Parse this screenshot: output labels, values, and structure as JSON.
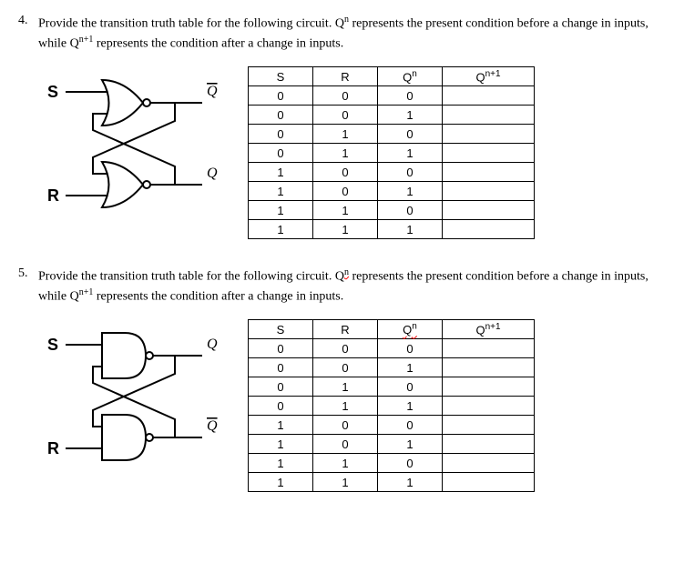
{
  "problems": [
    {
      "number": "4.",
      "text_pre": "Provide the transition truth table for the following circuit. Q",
      "sup1": "n",
      "text_mid": " represents the present condition before a change in inputs, while Q",
      "sup2": "n+1",
      "text_post": " represents the condition after a change in inputs.",
      "gate": "nor",
      "q_top_bar": true,
      "headers": {
        "c1": "S",
        "c2": "R",
        "c3": "Q",
        "c3_sup": "n",
        "c4": "Q",
        "c4_sup": "n+1",
        "squiggle": false
      },
      "rows": [
        [
          "0",
          "0",
          "0",
          ""
        ],
        [
          "0",
          "0",
          "1",
          ""
        ],
        [
          "0",
          "1",
          "0",
          ""
        ],
        [
          "0",
          "1",
          "1",
          ""
        ],
        [
          "1",
          "0",
          "0",
          ""
        ],
        [
          "1",
          "0",
          "1",
          ""
        ],
        [
          "1",
          "1",
          "0",
          ""
        ],
        [
          "1",
          "1",
          "1",
          ""
        ]
      ]
    },
    {
      "number": "5.",
      "text_pre": "Provide the transition truth table for the following circuit. Q",
      "sup1": "n",
      "text_mid": " represents the present condition before a change in inputs, while Q",
      "sup2": "n+1",
      "text_post": " represents the condition after a change in inputs.",
      "gate": "nand",
      "q_top_bar": false,
      "headers": {
        "c1": "S",
        "c2": "R",
        "c3": "Q",
        "c3_sup": "n",
        "c4": "Q",
        "c4_sup": "n+1",
        "squiggle": true
      },
      "rows": [
        [
          "0",
          "0",
          "0",
          ""
        ],
        [
          "0",
          "0",
          "1",
          ""
        ],
        [
          "0",
          "1",
          "0",
          ""
        ],
        [
          "0",
          "1",
          "1",
          ""
        ],
        [
          "1",
          "0",
          "0",
          ""
        ],
        [
          "1",
          "0",
          "1",
          ""
        ],
        [
          "1",
          "1",
          "0",
          ""
        ],
        [
          "1",
          "1",
          "1",
          ""
        ]
      ]
    }
  ],
  "labels": {
    "S": "S",
    "R": "R",
    "Q": "Q",
    "Qbar": "Q"
  }
}
